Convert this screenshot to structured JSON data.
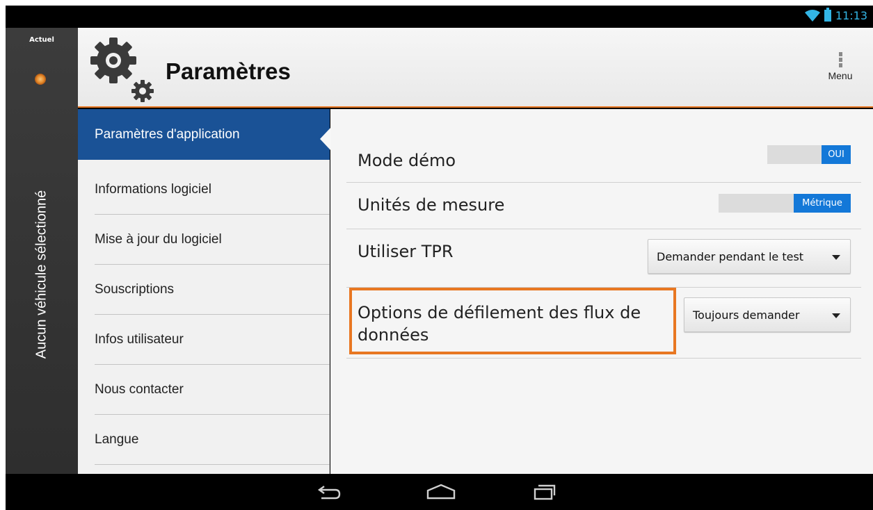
{
  "status_bar": {
    "time": "11:13"
  },
  "rail": {
    "current_label": "Actuel",
    "vehicle_status": "Aucun véhicule sélectionné"
  },
  "header": {
    "title": "Paramètres",
    "menu_label": "Menu"
  },
  "sidebar": {
    "items": [
      {
        "label": "Paramètres d'application",
        "active": true
      },
      {
        "label": "Informations logiciel"
      },
      {
        "label": "Mise à jour du logiciel"
      },
      {
        "label": "Souscriptions"
      },
      {
        "label": "Infos utilisateur"
      },
      {
        "label": "Nous contacter"
      },
      {
        "label": "Langue"
      }
    ]
  },
  "settings": {
    "demo_mode": {
      "label": "Mode démo",
      "value": "OUI"
    },
    "units": {
      "label": "Unités de mesure",
      "value": "Métrique"
    },
    "tpr": {
      "label": "Utiliser TPR",
      "value": "Demander pendant le test"
    },
    "scroll": {
      "label_line1": "Options de défilement des flux de",
      "label_line2": "données",
      "value": "Toujours demander"
    }
  },
  "colors": {
    "accent": "#e87722",
    "active": "#1a5296",
    "toggle_on": "#1378d8",
    "status": "#33b5e5"
  },
  "nav_icons": [
    "back-icon",
    "home-icon",
    "recent-apps-icon"
  ]
}
